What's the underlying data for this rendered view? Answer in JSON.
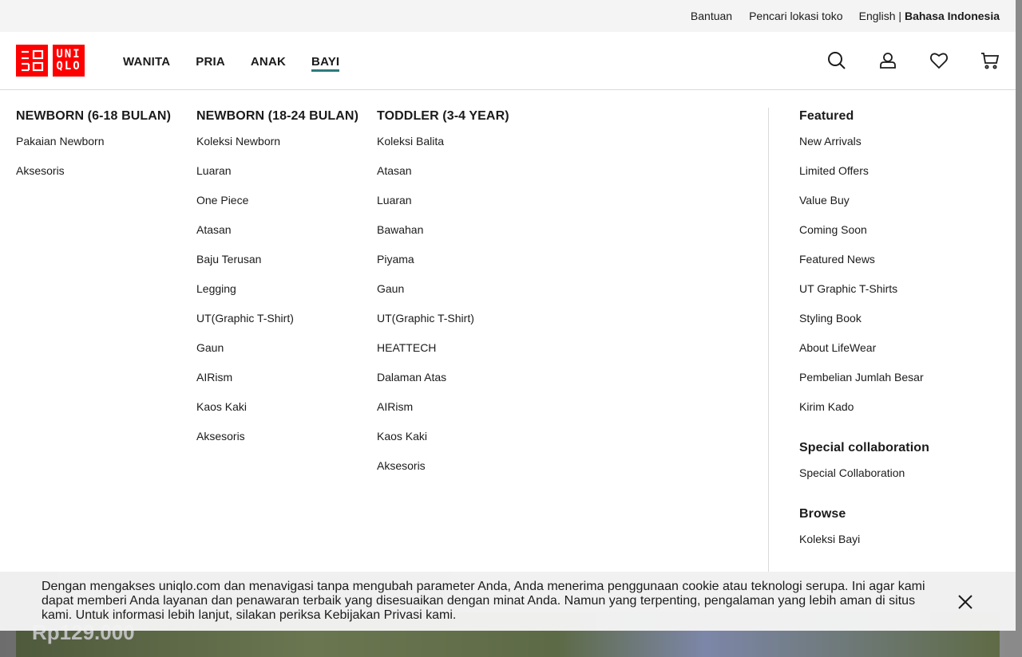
{
  "hero": {
    "price": "Rp129.000"
  },
  "utility": {
    "help": "Bantuan",
    "store_locator": "Pencari lokasi toko",
    "lang_en": "English |",
    "lang_id": "Bahasa Indonesia"
  },
  "logo": {
    "left": "UNI QLO",
    "line1": "UNI",
    "line2": "QLO"
  },
  "nav": {
    "women": "WANITA",
    "men": "PRIA",
    "kids": "ANAK",
    "baby": "BAYI"
  },
  "icons": [
    "search-icon",
    "account-icon",
    "wishlist-heart-icon",
    "cart-icon"
  ],
  "menu": {
    "col1": {
      "title": "NEWBORN (6-18 BULAN)",
      "items": [
        "Pakaian Newborn",
        "Aksesoris"
      ]
    },
    "col2": {
      "title": "NEWBORN (18-24 BULAN)",
      "items": [
        "Koleksi Newborn",
        "Luaran",
        "One Piece",
        "Atasan",
        "Baju Terusan",
        "Legging",
        "UT(Graphic T-Shirt)",
        "Gaun",
        "AIRism",
        "Kaos Kaki",
        "Aksesoris"
      ]
    },
    "col3": {
      "title": "TODDLER (3-4 YEAR)",
      "items": [
        "Koleksi Balita",
        "Atasan",
        "Luaran",
        "Bawahan",
        "Piyama",
        "Gaun",
        "UT(Graphic T-Shirt)",
        "HEATTECH",
        "Dalaman Atas",
        "AIRism",
        "Kaos Kaki",
        "Aksesoris"
      ]
    },
    "featured": {
      "title": "Featured",
      "items": [
        "New Arrivals",
        "Limited Offers",
        "Value Buy",
        "Coming Soon",
        "Featured News",
        "UT Graphic T-Shirts",
        "Styling Book",
        "About LifeWear",
        "Pembelian Jumlah Besar",
        "Kirim Kado"
      ]
    },
    "collab": {
      "title": "Special collaboration",
      "items": [
        "Special Collaboration"
      ]
    },
    "browse": {
      "title": "Browse",
      "items": [
        "Koleksi Bayi"
      ]
    }
  },
  "cookie": {
    "text": "Dengan mengakses uniqlo.com dan menavigasi tanpa mengubah parameter Anda, Anda menerima penggunaan cookie atau teknologi serupa. Ini agar kami dapat memberi Anda layanan dan penawaran terbaik yang disesuaikan dengan minat Anda. Namun yang terpenting, pengalaman yang lebih aman di situs kami. Untuk informasi lebih lanjut, silakan periksa Kebijakan Privasi kami."
  },
  "colors": {
    "brand": "#ff0000",
    "active_underline": "#2c7a7b"
  }
}
